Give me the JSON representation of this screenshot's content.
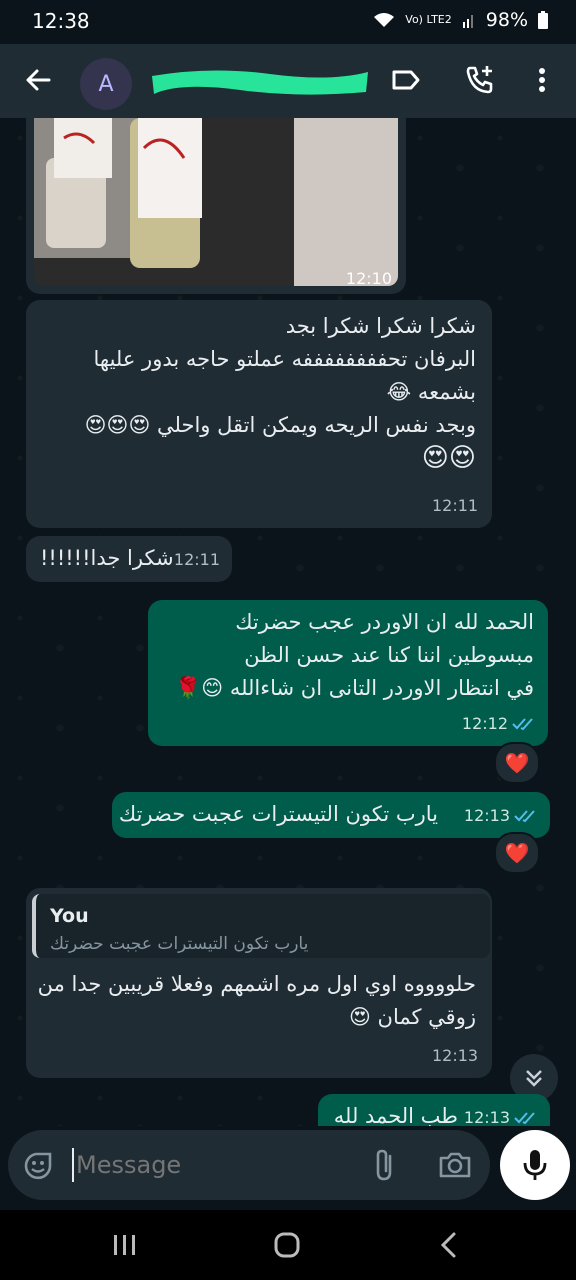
{
  "status_bar": {
    "time": "12:38",
    "signal_text": "Vo) LTE2",
    "battery": "98%"
  },
  "header": {
    "avatar_letter": "A",
    "contact_name_hidden": true
  },
  "messages": [
    {
      "id": "img",
      "type": "image",
      "direction": "incoming",
      "time": "12:10"
    },
    {
      "id": "m1",
      "direction": "incoming",
      "lines": [
        "شكرا شكرا شكرا بجد",
        "البرفان تحففففففففه عملتو حاجه بدور عليها",
        "بشمعه 😂",
        "وبجد نفس الريحه ويمكن اتقل واحلي 😍😍😍",
        "😍😍"
      ],
      "time": "12:11"
    },
    {
      "id": "m2",
      "direction": "incoming",
      "lines": [
        "شكرا جدا!!!!!!"
      ],
      "time": "12:11"
    },
    {
      "id": "m3",
      "direction": "outgoing",
      "lines": [
        "الحمد لله  ان الاوردر عجب حضرتك",
        "مبسوطين اننا كنا عند حسن الظن",
        "في انتظار الاوردر التانى ان شاءالله 😊🌹"
      ],
      "time": "12:12",
      "reaction": "❤️"
    },
    {
      "id": "m4",
      "direction": "outgoing",
      "lines": [
        "يارب تكون التيسترات  عجبت حضرتك"
      ],
      "time": "12:13",
      "reaction": "❤️"
    },
    {
      "id": "m5",
      "direction": "incoming",
      "reply_to": {
        "author": "You",
        "text": "يارب تكون التيسترات  عجبت حضرتك"
      },
      "lines": [
        "حلووووه اوي اول مره اشمهم وفعلا قريبين جدا من",
        "زوقي كمان 😍"
      ],
      "time": "12:13"
    },
    {
      "id": "m6",
      "direction": "outgoing",
      "lines": [
        "طب الحمد لله"
      ],
      "time": "12:13"
    }
  ],
  "composer": {
    "placeholder": "Message"
  },
  "colors": {
    "background": "#0b141a",
    "incoming": "#1f2c34",
    "outgoing": "#005c4b",
    "ticks": "#53bdeb",
    "accent_blur": "#28e49b"
  }
}
